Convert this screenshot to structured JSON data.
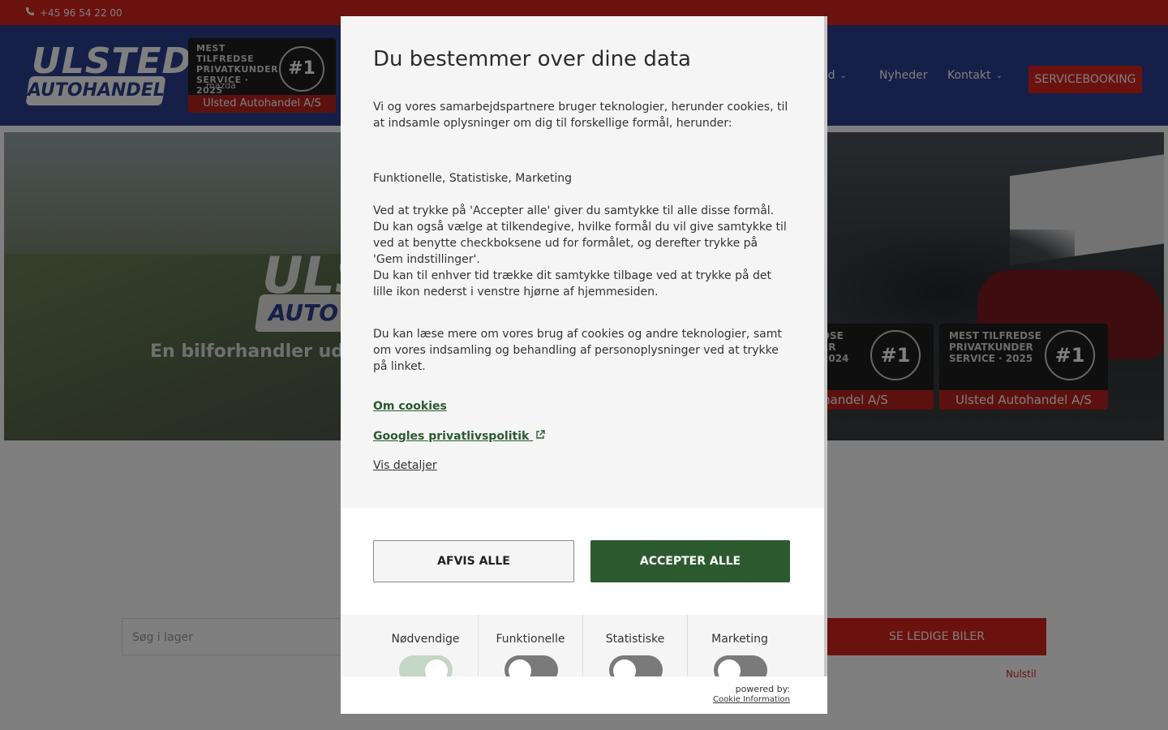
{
  "topbar": {
    "phone": "+45 96 54 22 00"
  },
  "header": {
    "logo_line1": "ULSTED",
    "logo_line2": "AUTOHANDEL",
    "badge_text": "MEST TILFREDSE PRIVATKUNDER SERVICE · 2025",
    "badge_number": "#1",
    "badge_brand": "mazda",
    "badge_footer": "Ulsted Autohandel A/S",
    "nav": [
      {
        "label": "ed"
      },
      {
        "label": "Nyheder"
      },
      {
        "label": "Kontakt"
      }
    ],
    "service_button": "SERVICEBOOKING"
  },
  "hero": {
    "logo_line1": "ULS",
    "logo_line2": "AUTO",
    "tagline": "En bilforhandler ud",
    "badge1_text": "DSE\nER\n2024",
    "badge1_number": "#1",
    "badge1_footer": "tohandel A/S",
    "badge2_text": "MEST TILFREDSE\nPRIVATKUNDER\nSERVICE · 2025",
    "badge2_number": "#1",
    "badge2_footer": "Ulsted Autohandel A/S"
  },
  "search": {
    "placeholder": "Søg i lager",
    "button": "SE LEDIGE BILER",
    "reset": "Nulstil"
  },
  "consent": {
    "title": "Du bestemmer over dine data",
    "intro": "Vi og vores samarbejdspartnere bruger teknologier, herunder cookies, til at indsamle oplysninger om dig til forskellige formål, herunder:",
    "purposes": "Funktionelle, Statistiske, Marketing",
    "accept_info": "Ved at trykke på 'Accepter alle' giver du samtykke til alle disse formål. Du kan også vælge at tilkendegive, hvilke formål du vil give samtykke til ved at benytte checkboksene ud for formålet, og derefter trykke på 'Gem indstillinger'.",
    "withdraw_info": "Du kan til enhver tid trække dit samtykke tilbage ved at trykke på det lille ikon nederst i venstre hjørne af hjemmesiden.",
    "read_more": "Du kan læse mere om vores brug af cookies og andre teknologier, samt om vores indsamling og behandling af personoplysninger ved at trykke på linket.",
    "link_cookies": "Om cookies",
    "link_google": "Googles privatlivspolitik",
    "link_details": "Vis detaljer",
    "decline_button": "AFVIS ALLE",
    "accept_button": "ACCEPTER ALLE",
    "toggles": [
      {
        "label": "Nødvendige",
        "state": "on"
      },
      {
        "label": "Funktionelle",
        "state": "off"
      },
      {
        "label": "Statistiske",
        "state": "off"
      },
      {
        "label": "Marketing",
        "state": "off"
      }
    ],
    "powered_by": "powered by:",
    "provider": "Cookie Information"
  },
  "colors": {
    "brand_red": "#d6241c",
    "brand_blue": "#2c3e8f",
    "accept_green": "#2c5a2f"
  }
}
